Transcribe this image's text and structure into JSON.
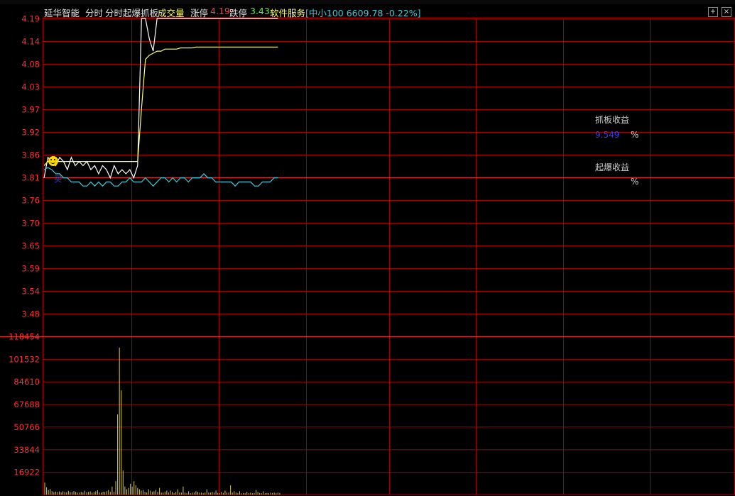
{
  "header": {
    "stock_name": "延华智能",
    "tab_fenshi": "分时",
    "indicator_name": "分时起爆抓板",
    "volume_label": "成交量",
    "limit_up_label": "涨停",
    "limit_up_value": "4.19",
    "limit_down_label": "跌停",
    "limit_down_value": "3.43",
    "sector": "软件服务",
    "index_text": "[中小100 6609.78 -0.22%]",
    "btn_add": "+",
    "btn_close": "×"
  },
  "colors": {
    "grid": "#a00000",
    "axis_label": "#ff3030",
    "price_line": "#ffffff",
    "avg_line": "#ffff66",
    "macd_line": "#40c8d8",
    "volume_bar": "#d8c84a",
    "note_title": "#ff2020",
    "note_value": "#3a3aff"
  },
  "icons": {
    "marker": "smiley-icon"
  },
  "chart_data": [
    {
      "type": "line",
      "title": "",
      "y_ticks": [
        "4.19",
        "4.14",
        "4.08",
        "4.03",
        "3.97",
        "3.92",
        "3.86",
        "3.81",
        "3.76",
        "3.70",
        "3.65",
        "3.59",
        "3.54",
        "3.48"
      ],
      "ylim": [
        3.45,
        4.2
      ],
      "session_fraction": 0.285,
      "series": [
        {
          "role": "price",
          "values": [
            3.81,
            3.86,
            3.85,
            3.84,
            3.86,
            3.85,
            3.83,
            3.86,
            3.84,
            3.85,
            3.84,
            3.85,
            3.83,
            3.84,
            3.82,
            3.84,
            3.83,
            3.81,
            3.84,
            3.82,
            3.83,
            3.82,
            3.83,
            3.81,
            3.84,
            4.2,
            4.2,
            4.15,
            4.12,
            4.2,
            4.2,
            4.2,
            4.2,
            4.2,
            4.2,
            4.2,
            4.2,
            4.2,
            4.2,
            4.2,
            4.2,
            4.2,
            4.2,
            4.2,
            4.2,
            4.2,
            4.2,
            4.2,
            4.2,
            4.2,
            4.2,
            4.2,
            4.2,
            4.2,
            4.2,
            4.2,
            4.2,
            4.2,
            4.2,
            4.2,
            4.2
          ]
        },
        {
          "role": "average",
          "values": [
            3.84,
            3.85,
            3.85,
            3.85,
            3.85,
            3.85,
            3.85,
            3.85,
            3.85,
            3.85,
            3.85,
            3.85,
            3.85,
            3.85,
            3.85,
            3.85,
            3.85,
            3.85,
            3.85,
            3.85,
            3.85,
            3.85,
            3.85,
            3.85,
            3.85,
            3.98,
            4.1,
            4.11,
            4.115,
            4.12,
            4.12,
            4.125,
            4.125,
            4.125,
            4.125,
            4.128,
            4.128,
            4.128,
            4.128,
            4.13,
            4.13,
            4.13,
            4.13,
            4.13,
            4.13,
            4.13,
            4.13,
            4.13,
            4.13,
            4.13,
            4.13,
            4.13,
            4.13,
            4.13,
            4.13,
            4.13,
            4.13,
            4.13,
            4.13,
            4.13,
            4.13
          ]
        },
        {
          "role": "indicator",
          "values": [
            3.83,
            3.835,
            3.83,
            3.82,
            3.82,
            3.81,
            3.81,
            3.8,
            3.8,
            3.8,
            3.79,
            3.79,
            3.8,
            3.79,
            3.8,
            3.79,
            3.8,
            3.8,
            3.79,
            3.79,
            3.8,
            3.8,
            3.81,
            3.8,
            3.8,
            3.8,
            3.81,
            3.8,
            3.79,
            3.8,
            3.81,
            3.81,
            3.8,
            3.81,
            3.8,
            3.81,
            3.81,
            3.8,
            3.81,
            3.81,
            3.81,
            3.82,
            3.81,
            3.81,
            3.8,
            3.8,
            3.8,
            3.8,
            3.8,
            3.79,
            3.8,
            3.8,
            3.8,
            3.8,
            3.79,
            3.79,
            3.8,
            3.8,
            3.8,
            3.81,
            3.81
          ]
        }
      ]
    },
    {
      "type": "bar",
      "title": "",
      "y_ticks": [
        "118454",
        "101532",
        "84610",
        "67688",
        "50766",
        "33844",
        "16922"
      ],
      "ylim": [
        0,
        118454
      ],
      "values": [
        9000,
        5500,
        3500,
        4200,
        2500,
        1800,
        2200,
        2000,
        2300,
        1800,
        2500,
        2000,
        1600,
        2800,
        2000,
        1900,
        2600,
        2000,
        1500,
        1500,
        2100,
        1600,
        2900,
        1800,
        2000,
        2400,
        1500,
        1900,
        2500,
        3200,
        1600,
        1500,
        2100,
        1900,
        2500,
        3500,
        2000,
        6000,
        2000,
        10000,
        60000,
        110000,
        78000,
        18000,
        6000,
        4000,
        5000,
        8000,
        6000,
        10000,
        7000,
        5000,
        4000,
        3000,
        3500,
        2000,
        1500,
        4000,
        3000,
        2000,
        2500,
        3500,
        2000,
        5000,
        1500,
        1500,
        2000,
        3000,
        1500,
        3000,
        2000,
        1000,
        2000,
        4000,
        1500,
        1500,
        6000,
        1500,
        1000,
        2500,
        1000,
        1500,
        1500,
        2500,
        2000,
        1500,
        1500,
        1000,
        1500,
        4000,
        1500,
        1500,
        2000,
        1500,
        3000,
        1200,
        1000,
        2000,
        1200,
        3000,
        1500,
        1500,
        7000,
        1500,
        2500,
        1500,
        1000,
        2500,
        1000,
        1200,
        1000,
        2000,
        1000,
        1500,
        1000,
        1200,
        3500,
        2000,
        1200,
        1000,
        2500,
        1000,
        1200,
        1000,
        1500,
        1200,
        1500,
        1000,
        1500,
        1200
      ]
    }
  ],
  "notes": {
    "zhuaban_title": "抓板收益",
    "zhuaban_value": "9.549",
    "zhuaban_pct": "%",
    "qibao_title": "起爆收益",
    "qibao_pct": "%",
    "buy_marker": "买"
  }
}
